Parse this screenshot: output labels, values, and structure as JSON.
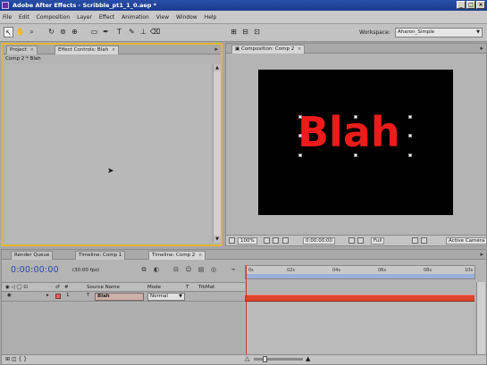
{
  "app": {
    "title": "Adobe After Effects - Scribble_pt1_1_0.aep *",
    "window_buttons": [
      "_",
      "□",
      "×"
    ]
  },
  "menu": [
    "File",
    "Edit",
    "Composition",
    "Layer",
    "Effect",
    "Animation",
    "View",
    "Window",
    "Help"
  ],
  "toolbar": {
    "tools": [
      {
        "name": "selection-tool-icon",
        "glyph": "↖",
        "selected": true
      },
      {
        "name": "hand-tool-icon",
        "glyph": "✋"
      },
      {
        "name": "zoom-tool-icon",
        "glyph": "⌕"
      },
      {
        "name": "rotation-tool-icon",
        "glyph": "↻"
      },
      {
        "name": "orbit-camera-icon",
        "glyph": "⊚"
      },
      {
        "name": "pan-behind-icon",
        "glyph": "⊕"
      },
      {
        "name": "mask-tool-icon",
        "glyph": "▭"
      },
      {
        "name": "pen-tool-icon",
        "glyph": "✒"
      },
      {
        "name": "text-tool-icon",
        "glyph": "T"
      },
      {
        "name": "brush-tool-icon",
        "glyph": "✎"
      },
      {
        "name": "clone-stamp-icon",
        "glyph": "⊥"
      },
      {
        "name": "eraser-tool-icon",
        "glyph": "⌫"
      }
    ],
    "workspace_label": "Workspace:",
    "workspace_value": "Aharon_Simple"
  },
  "left_panel": {
    "tabs": [
      {
        "label": "Project",
        "close": "×",
        "active": false
      },
      {
        "label": "Effect Controls: Blah",
        "close": "×",
        "active": true
      }
    ],
    "layer_path": "Comp 2 * Blah"
  },
  "comp_panel": {
    "tab": "Composition: Comp 2",
    "close": "×",
    "canvas_text": "Blah",
    "text_color": "#ee1b1b",
    "footer": {
      "magnification": "100%",
      "timecode": "0:00:00:00",
      "resolution": "Full",
      "camera": "Active Camera"
    }
  },
  "timeline": {
    "tabs": [
      {
        "label": "Render Queue",
        "active": false
      },
      {
        "label": "Timeline: Comp 1",
        "active": false
      },
      {
        "label": "Timeline: Comp 2",
        "active": true
      }
    ],
    "close": "×",
    "current_time": "0:00:00:00",
    "fps": "(30.00 fps)",
    "ruler_ticks": [
      "0s",
      "02s",
      "04s",
      "06s",
      "08s",
      "10s"
    ],
    "columns": {
      "number": "#",
      "source_name": "Source Name",
      "mode": "Mode",
      "t": "T",
      "trkmat": "TrkMat"
    },
    "layers": [
      {
        "number": "1",
        "type_icon": "T",
        "name": "Blah",
        "mode": "Normal",
        "label_color": "#e06060"
      }
    ],
    "bar_color": "#e0432e"
  },
  "colors": {
    "active_panel_border": "#e5b530",
    "timecode_blue": "#2a4aa8",
    "title_blue": "#1a3a8f"
  }
}
